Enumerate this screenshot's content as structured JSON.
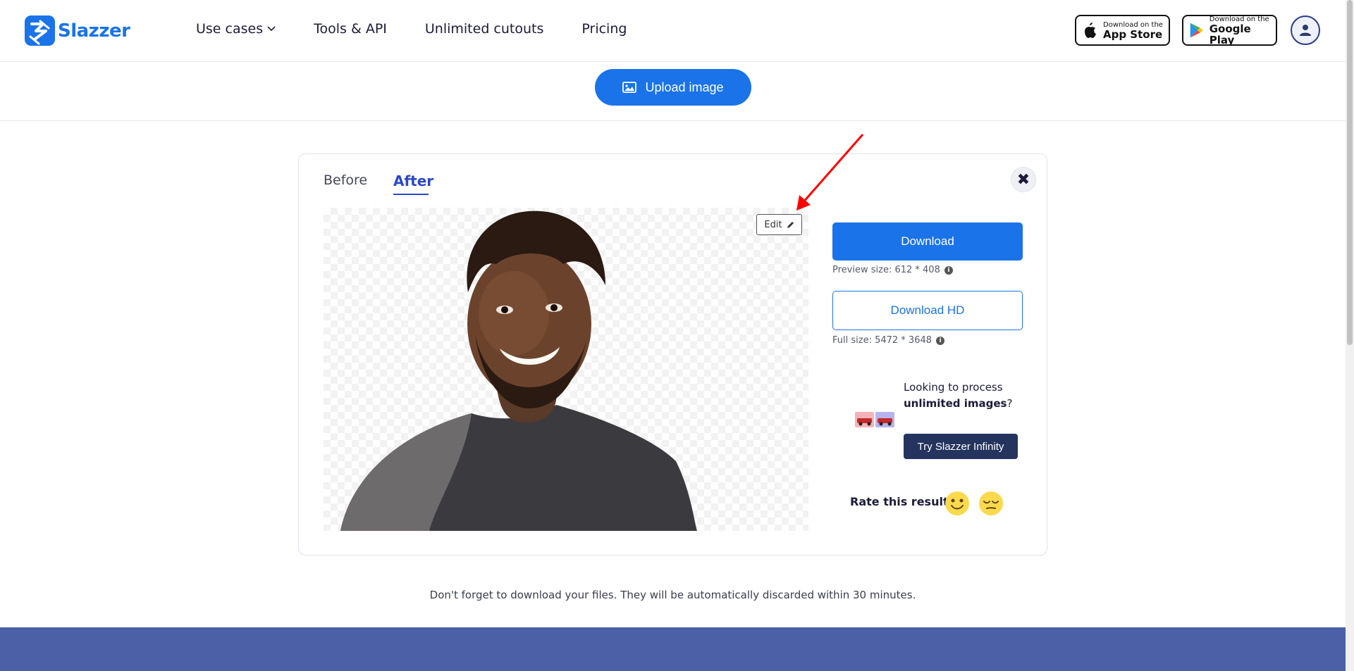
{
  "header": {
    "logo_text": "Slazzer",
    "nav": [
      {
        "label": "Use cases"
      },
      {
        "label": "Tools & API"
      },
      {
        "label": "Unlimited cutouts"
      },
      {
        "label": "Pricing"
      }
    ],
    "app_store": {
      "small": "Download on the",
      "big": "App Store"
    },
    "google_play": {
      "small": "Download on the",
      "big": "Google Play"
    }
  },
  "upload": {
    "label": "Upload image"
  },
  "card": {
    "tabs": {
      "before": "Before",
      "after": "After"
    },
    "close_symbol": "✖",
    "edit_label": "Edit",
    "download_label": "Download",
    "preview_size": "Preview size: 612 * 408",
    "download_hd_label": "Download HD",
    "full_size": "Full size: 5472 * 3648",
    "promo": {
      "line1": "Looking to process ",
      "bold1": "unlimited images",
      "line_end": "?",
      "button": "Try Slazzer Infinity"
    },
    "rate_label": "Rate this result:"
  },
  "notice": "Don't forget to download your files. They will be automatically discarded within 30 minutes.",
  "colors": {
    "brand": "#1a73e8",
    "accent_tab": "#2b48c8",
    "infinity_btn": "#24345e",
    "footer": "#4c60a7"
  },
  "icons": [
    "chevron-down-icon",
    "apple-icon",
    "google-play-icon",
    "user-icon",
    "image-icon",
    "close-icon",
    "pencil-icon",
    "info-icon",
    "smile-emoji-icon",
    "relieved-emoji-icon",
    "red-arrow-annotation"
  ]
}
